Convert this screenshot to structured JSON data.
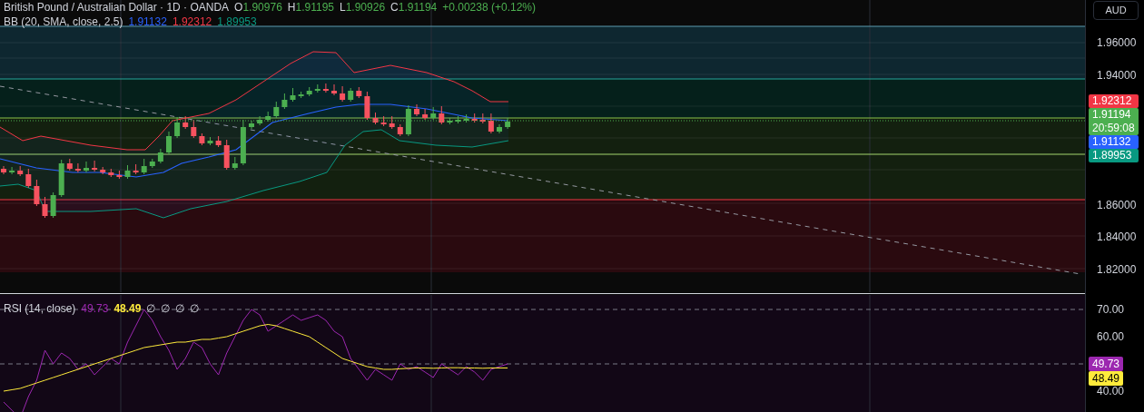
{
  "legend": {
    "symbol": "British Pound / Australian Dollar · 1D · OANDA",
    "ohlc": [
      {
        "label": "O",
        "value": "1.90976"
      },
      {
        "label": "H",
        "value": "1.91195"
      },
      {
        "label": "L",
        "value": "1.90926"
      },
      {
        "label": "C",
        "value": "1.91194"
      }
    ],
    "change": "+0.00238 (+0.12%)"
  },
  "indicator": {
    "name": "BB (20, SMA, close, 2.5)",
    "values": [
      {
        "text": "1.91132",
        "color": "#2962ff"
      },
      {
        "text": "1.92312",
        "color": "#f23645"
      },
      {
        "text": "1.89953",
        "color": "#089981"
      }
    ]
  },
  "price_axis": {
    "currency": "AUD",
    "ticks": [
      "1.96000",
      "1.94000",
      "1.86000",
      "1.84000",
      "1.82000"
    ],
    "badges": [
      {
        "text": "1.92312",
        "color": "#f23645"
      },
      {
        "text": "1.91194",
        "subtext": "20:59:08",
        "color": "#4caf50"
      },
      {
        "text": "1.91132",
        "color": "#2962ff"
      },
      {
        "text": "1.89953",
        "color": "#089981"
      }
    ]
  },
  "rsi": {
    "name": "RSI (14, close)",
    "values": [
      {
        "text": "49.73",
        "color": "#9c27b0"
      },
      {
        "text": "48.49",
        "color": "#ffeb3b"
      }
    ],
    "extras": [
      "∅",
      "∅",
      "∅",
      "∅"
    ],
    "axis_ticks": [
      "70.00",
      "60.00",
      "40.00"
    ],
    "badges": [
      {
        "text": "49.73",
        "color": "#9c27b0"
      },
      {
        "text": "48.49",
        "color": "#ffeb3b"
      }
    ]
  }
}
